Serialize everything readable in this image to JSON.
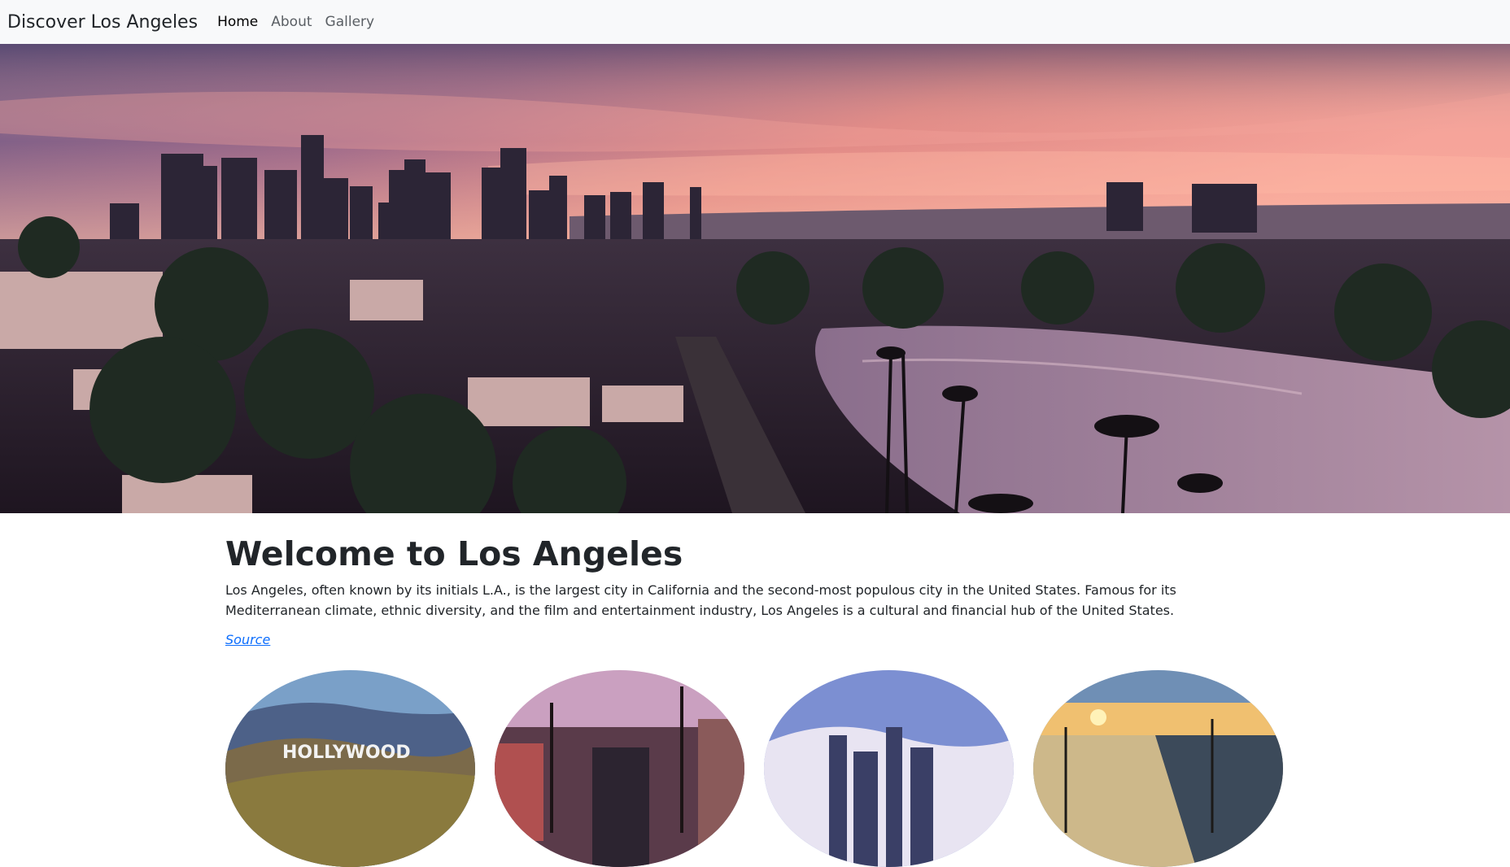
{
  "navbar": {
    "brand": "Discover Los Angeles",
    "links": [
      {
        "label": "Home",
        "active": true
      },
      {
        "label": "About",
        "active": false
      },
      {
        "label": "Gallery",
        "active": false
      }
    ]
  },
  "hero": {
    "image": "los-angeles-sunset-skyline"
  },
  "main": {
    "title": "Welcome to Los Angeles",
    "intro": "Los Angeles, often known by its initials L.A., is the largest city in California and the second-most populous city in the United States. Famous for its Mediterranean climate, ethnic diversity, and the film and entertainment industry, Los Angeles is a cultural and financial hub of the United States.",
    "source_label": "Source"
  },
  "gallery": {
    "items": [
      {
        "image": "hollywood-sign",
        "sign_text": "HOLLYWOOD"
      },
      {
        "image": "hollywood-boulevard-street"
      },
      {
        "image": "downtown-skyline-mountains"
      },
      {
        "image": "santa-monica-beach-sunset"
      }
    ]
  },
  "colors": {
    "navbar_bg": "#f8f9fa",
    "link": "#0d6efd",
    "text": "#212529"
  }
}
